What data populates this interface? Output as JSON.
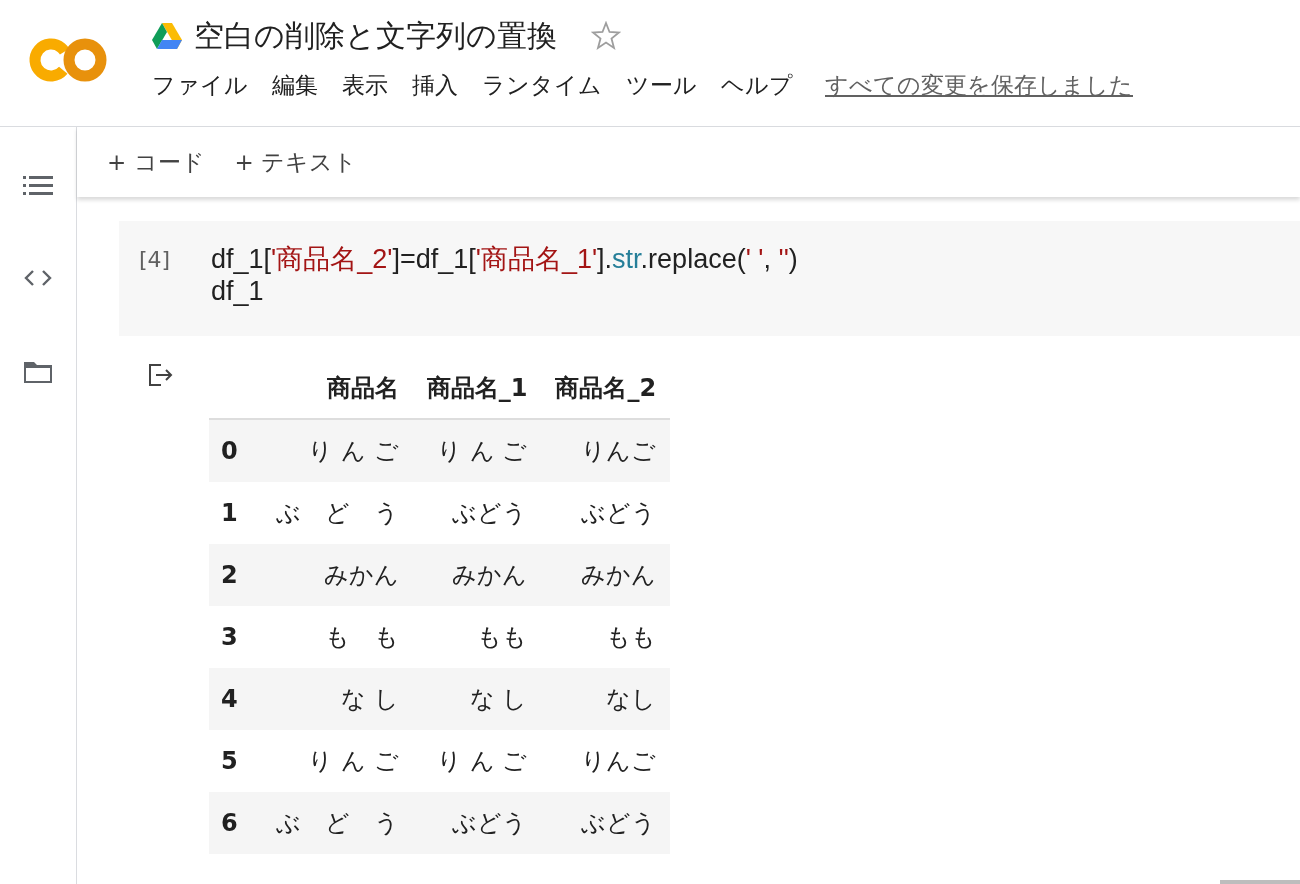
{
  "header": {
    "title": "空白の削除と文字列の置換",
    "starred": false,
    "menu": [
      "ファイル",
      "編集",
      "表示",
      "挿入",
      "ランタイム",
      "ツール",
      "ヘルプ"
    ],
    "save_status": "すべての変更を保存しました"
  },
  "toolbar": [
    "+ コード",
    "+ テキスト"
  ],
  "cell": {
    "exec_count": "[4]",
    "lines": [
      [
        {
          "kind": "plain",
          "text": "df_1["
        },
        {
          "kind": "string",
          "text": "'商品名_2'"
        },
        {
          "kind": "plain",
          "text": "]=df_1["
        },
        {
          "kind": "string",
          "text": "'商品名_1'"
        },
        {
          "kind": "plain",
          "text": "]."
        },
        {
          "kind": "builtin",
          "text": "str"
        },
        {
          "kind": "plain",
          "text": ".replace("
        },
        {
          "kind": "string",
          "text": "' '"
        },
        {
          "kind": "plain",
          "text": ", "
        },
        {
          "kind": "string",
          "text": "''"
        },
        {
          "kind": "plain",
          "text": ")"
        }
      ],
      [
        {
          "kind": "plain",
          "text": "df_1"
        }
      ]
    ]
  },
  "output": {
    "table": {
      "columns": [
        "商品名",
        "商品名_1",
        "商品名_2"
      ],
      "rows": [
        {
          "index": "0",
          "cells": [
            "り ん ご",
            "り ん ご",
            "りんご"
          ]
        },
        {
          "index": "1",
          "cells": [
            "ぶ　ど　う",
            "ぶどう",
            "ぶどう"
          ]
        },
        {
          "index": "2",
          "cells": [
            "みかん",
            "みかん",
            "みかん"
          ]
        },
        {
          "index": "3",
          "cells": [
            "も　も",
            "もも",
            "もも"
          ]
        },
        {
          "index": "4",
          "cells": [
            "な し",
            "な し",
            "なし"
          ]
        },
        {
          "index": "5",
          "cells": [
            "り ん ご",
            "り ん ご",
            "りんご"
          ]
        },
        {
          "index": "6",
          "cells": [
            "ぶ　ど　う",
            "ぶどう",
            "ぶどう"
          ]
        }
      ]
    }
  }
}
